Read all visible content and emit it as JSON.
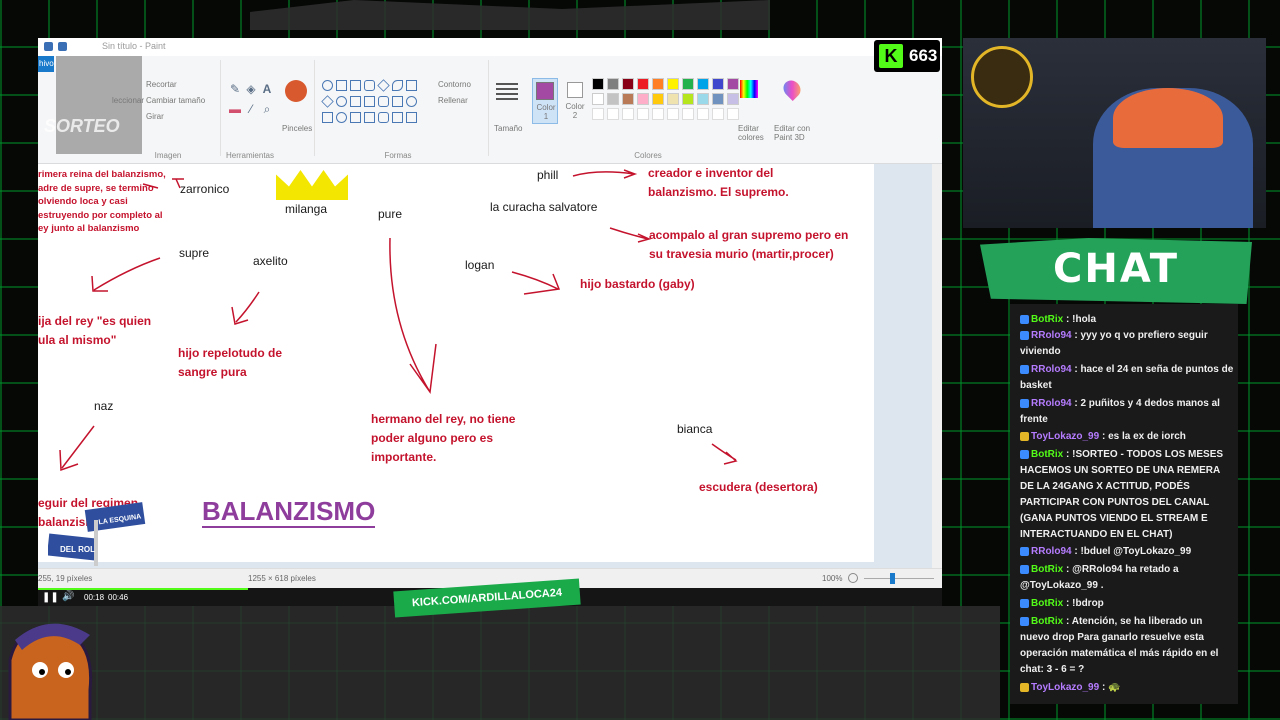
{
  "stream": {
    "viewers": "663",
    "kick_url": "KICK.COM/ARDILLALOCA24",
    "overlay_sorteo": "SORTEO",
    "chat_title": "CHAT"
  },
  "paint": {
    "window_title": "Sin título - Paint",
    "file_tab": "hivo",
    "ribbon": {
      "image_group": "Imagen",
      "recortar": "Recortar",
      "cambiar_tamano": "Cambiar tamaño",
      "girar": "Girar",
      "seleccionar": "leccionar",
      "herramientas": "Herramientas",
      "pinceles": "Pinceles",
      "formas": "Formas",
      "contorno": "Contorno",
      "rellenar": "Rellenar",
      "tamano": "Tamaño",
      "color1": "Color 1",
      "color2": "Color 2",
      "colores": "Colores",
      "editar_colores": "Editar colores",
      "editar_3d": "Editar con Paint 3D",
      "palette_row1": [
        "#000000",
        "#7f7f7f",
        "#880015",
        "#ed1c24",
        "#ff7f27",
        "#fff200",
        "#22b14c",
        "#00a2e8",
        "#3f48cc",
        "#a349a4"
      ],
      "palette_row2": [
        "#ffffff",
        "#c3c3c3",
        "#b97a57",
        "#ffaec9",
        "#ffc90e",
        "#efe4b0",
        "#b5e61d",
        "#99d9ea",
        "#7092be",
        "#c8bfe7"
      ],
      "color1_value": "#a349a4"
    },
    "canvas": {
      "names": {
        "zarronico": "zarronico",
        "milanga": "milanga",
        "pure": "pure",
        "phill": "phill",
        "curacha": "la curacha salvatore",
        "supre": "supre",
        "axelito": "axelito",
        "logan": "logan",
        "naz": "naz",
        "bianca": "bianca"
      },
      "notes": {
        "zarronico_note": [
          "rimera reina del balanzismo,",
          "adre de supre, se termino",
          "olviendo loca y casi",
          "estruyendo por completo al",
          "ey junto al balanzismo"
        ],
        "phill_note": [
          "creador e inventor del",
          "balanzismo. El supremo."
        ],
        "curacha_note": [
          "acompalo al gran supremo pero en",
          "su travesia murio (martir,procer)"
        ],
        "logan_note": "hijo bastardo (gaby)",
        "supre_note": [
          "ija del rey \"es quien",
          "ula al mismo\""
        ],
        "axelito_note": [
          "hijo repelotudo de",
          "sangre pura"
        ],
        "pure_note": [
          "hermano del rey, no tiene",
          "poder alguno pero es",
          "importante."
        ],
        "naz_note": [
          "eguir del regimen",
          "balanzismo\""
        ],
        "bianca_note": "escudera (desertora)"
      },
      "title": "BALANZISMO"
    },
    "status": {
      "position": "255, 19 píxeles",
      "size": "1255 × 618 píxeles",
      "zoom": "100%"
    },
    "video": {
      "time_current": "00:18",
      "time_total": "00:46"
    }
  },
  "overlay": {
    "street_top": "LA ESQUINA",
    "street_bottom": "DEL ROL"
  },
  "chat": [
    {
      "user": "BotRix",
      "color": "#53fc18",
      "text": "!hola"
    },
    {
      "user": "RRolo94",
      "color": "#b57cff",
      "text": "yyy yo q vo prefiero seguir viviendo"
    },
    {
      "user": "RRolo94",
      "color": "#b57cff",
      "text": "hace el 24 en seña de puntos de basket"
    },
    {
      "user": "RRolo94",
      "color": "#b57cff",
      "text": "2 puñitos y 4 dedos manos al frente"
    },
    {
      "user": "ToyLokazo_99",
      "color": "#b57cff",
      "text": "es la ex de iorch"
    },
    {
      "user": "BotRix",
      "color": "#53fc18",
      "text": "!SORTEO - TODOS LOS MESES HACEMOS UN SORTEO DE UNA REMERA DE LA 24GANG X ACTITUD, PODÉS PARTICIPAR CON PUNTOS DEL CANAL (GANA PUNTOS VIENDO EL STREAM E INTERACTUANDO EN EL CHAT)"
    },
    {
      "user": "RRolo94",
      "color": "#b57cff",
      "text": "!bduel @ToyLokazo_99"
    },
    {
      "user": "BotRix",
      "color": "#53fc18",
      "text": "@RRolo94 ha retado a @ToyLokazo_99 ."
    },
    {
      "user": "BotRix",
      "color": "#53fc18",
      "text": "!bdrop"
    },
    {
      "user": "BotRix",
      "color": "#53fc18",
      "text": "Atención, se ha liberado un nuevo drop Para ganarlo resuelve esta operación matemática el más rápido en el chat: 3 - 6 = ?"
    },
    {
      "user": "ToyLokazo_99",
      "color": "#b57cff",
      "text": "🐢"
    }
  ]
}
